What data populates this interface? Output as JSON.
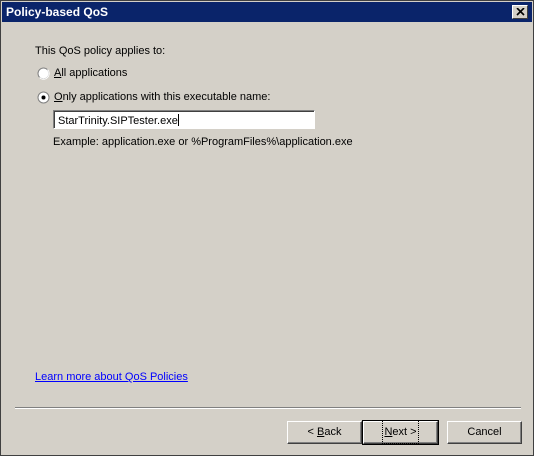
{
  "window": {
    "title": "Policy-based QoS"
  },
  "content": {
    "applies_label": "This QoS policy applies to:",
    "option_all": {
      "prefix": "",
      "accel": "A",
      "rest": "ll applications",
      "selected": false
    },
    "option_only": {
      "prefix": "",
      "accel": "O",
      "rest": "nly applications with this executable name:",
      "selected": true
    },
    "executable_value": "StarTrinity.SIPTester.exe",
    "example_text": "Example:  application.exe or %ProgramFiles%\\application.exe",
    "learn_more_link": "Learn more about QoS Policies"
  },
  "buttons": {
    "back": {
      "prefix": "< ",
      "accel": "B",
      "rest": "ack"
    },
    "next": {
      "prefix": "",
      "accel": "N",
      "rest": "ext >"
    },
    "cancel": {
      "label": "Cancel"
    }
  }
}
